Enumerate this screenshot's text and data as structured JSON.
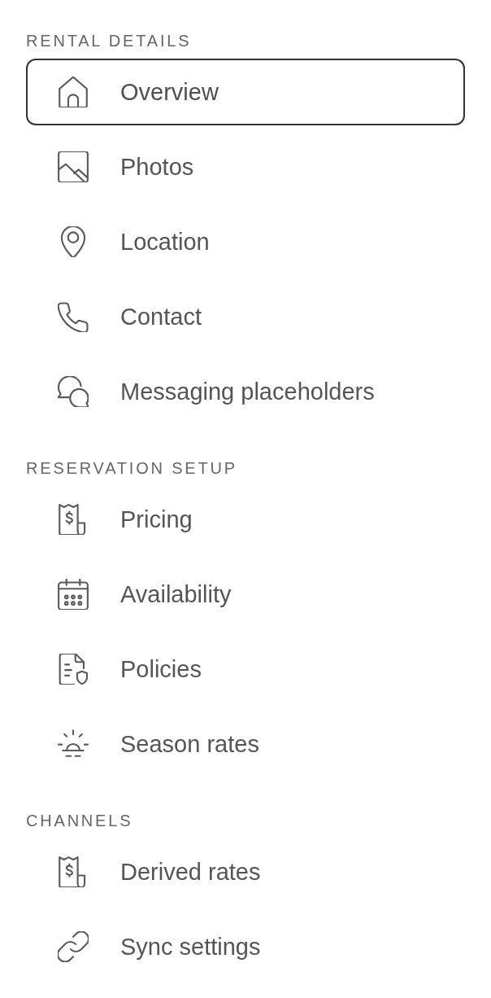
{
  "sections": [
    {
      "heading": "RENTAL DETAILS",
      "items": [
        {
          "label": "Overview",
          "kind": "house",
          "selected": true
        },
        {
          "label": "Photos",
          "kind": "picture",
          "selected": false
        },
        {
          "label": "Location",
          "kind": "pin",
          "selected": false
        },
        {
          "label": "Contact",
          "kind": "phone",
          "selected": false
        },
        {
          "label": "Messaging placeholders",
          "kind": "chat",
          "selected": false
        }
      ]
    },
    {
      "heading": "RESERVATION SETUP",
      "items": [
        {
          "label": "Pricing",
          "kind": "receipt",
          "selected": false
        },
        {
          "label": "Availability",
          "kind": "calendar",
          "selected": false
        },
        {
          "label": "Policies",
          "kind": "document",
          "selected": false
        },
        {
          "label": "Season rates",
          "kind": "sunrise",
          "selected": false
        }
      ]
    },
    {
      "heading": "CHANNELS",
      "items": [
        {
          "label": "Derived rates",
          "kind": "receipt",
          "selected": false
        },
        {
          "label": "Sync settings",
          "kind": "link",
          "selected": false
        }
      ]
    }
  ]
}
